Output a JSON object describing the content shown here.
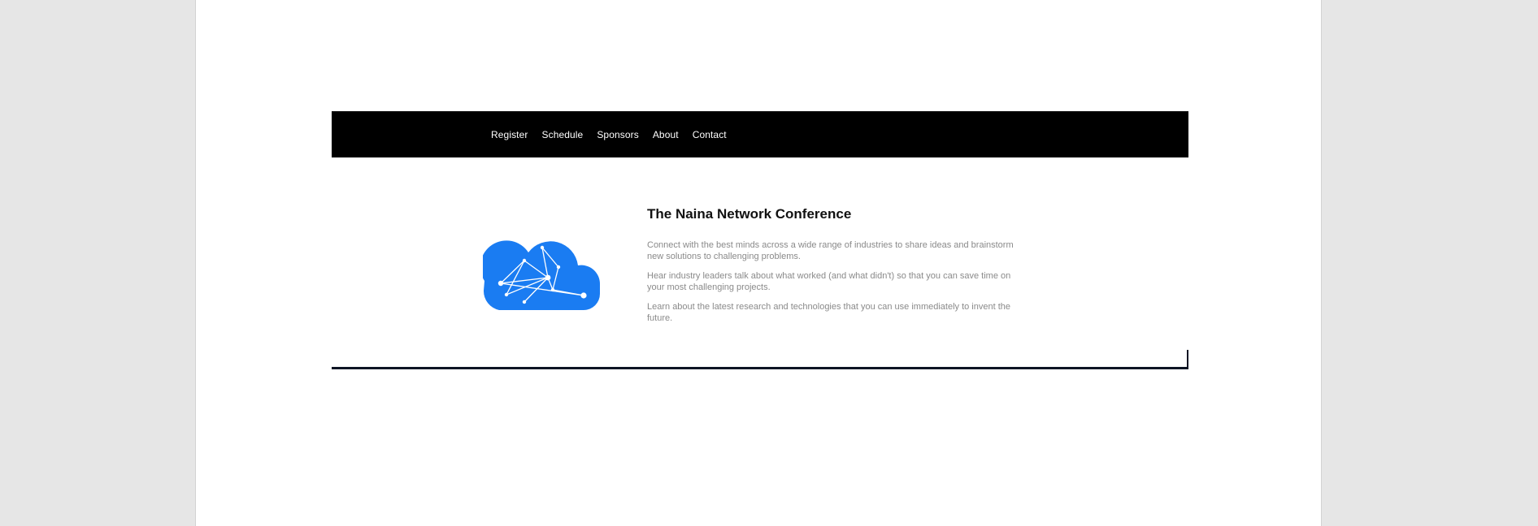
{
  "nav": {
    "items": [
      {
        "label": "Register"
      },
      {
        "label": "Schedule"
      },
      {
        "label": "Sponsors"
      },
      {
        "label": "About"
      },
      {
        "label": "Contact"
      }
    ]
  },
  "hero": {
    "icon": "cloud-network-icon",
    "accent_color": "#1a7cf2",
    "title": "The Naina Network Conference",
    "paragraphs": [
      "Connect with the best minds across a wide range of industries to share ideas and brainstorm new solutions to challenging problems.",
      "Hear industry leaders talk about what worked (and what didn't) so that you can save time on your most challenging projects.",
      "Learn about the latest research and technologies that you can use immediately to invent the future."
    ]
  }
}
